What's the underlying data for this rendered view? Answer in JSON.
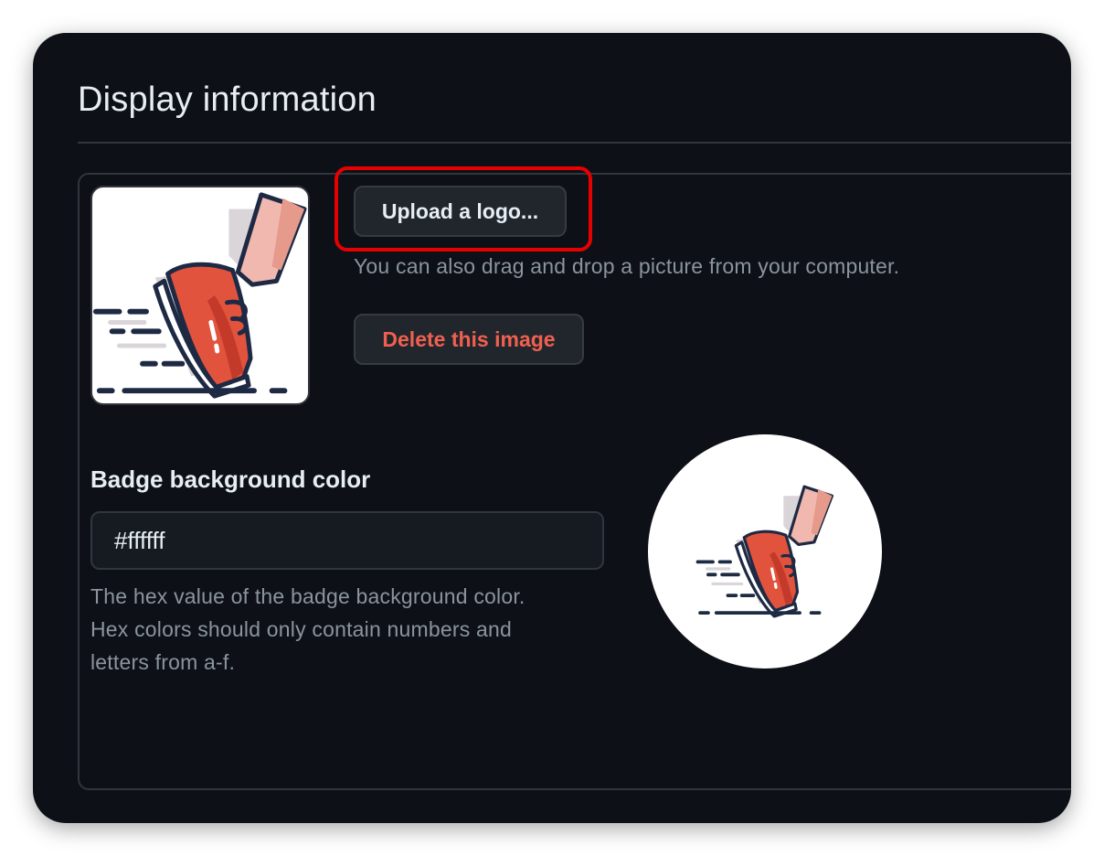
{
  "section": {
    "title": "Display information"
  },
  "logo_upload": {
    "upload_button_label": "Upload a logo...",
    "hint": "You can also drag and drop a picture from your computer.",
    "delete_button_label": "Delete this image",
    "logo_icon": "running-shoe-icon"
  },
  "badge": {
    "label": "Badge background color",
    "value": "#ffffff",
    "note_lines": [
      "The hex value of the badge background color.",
      "Hex colors should only contain numbers and",
      "letters from a-f."
    ],
    "preview_icon": "running-shoe-icon"
  },
  "colors": {
    "background": "#0d1117",
    "border": "#30363d",
    "text_primary": "#e6edf3",
    "text_muted": "#8b949e",
    "danger": "#f0604f",
    "highlight": "#e60000"
  }
}
